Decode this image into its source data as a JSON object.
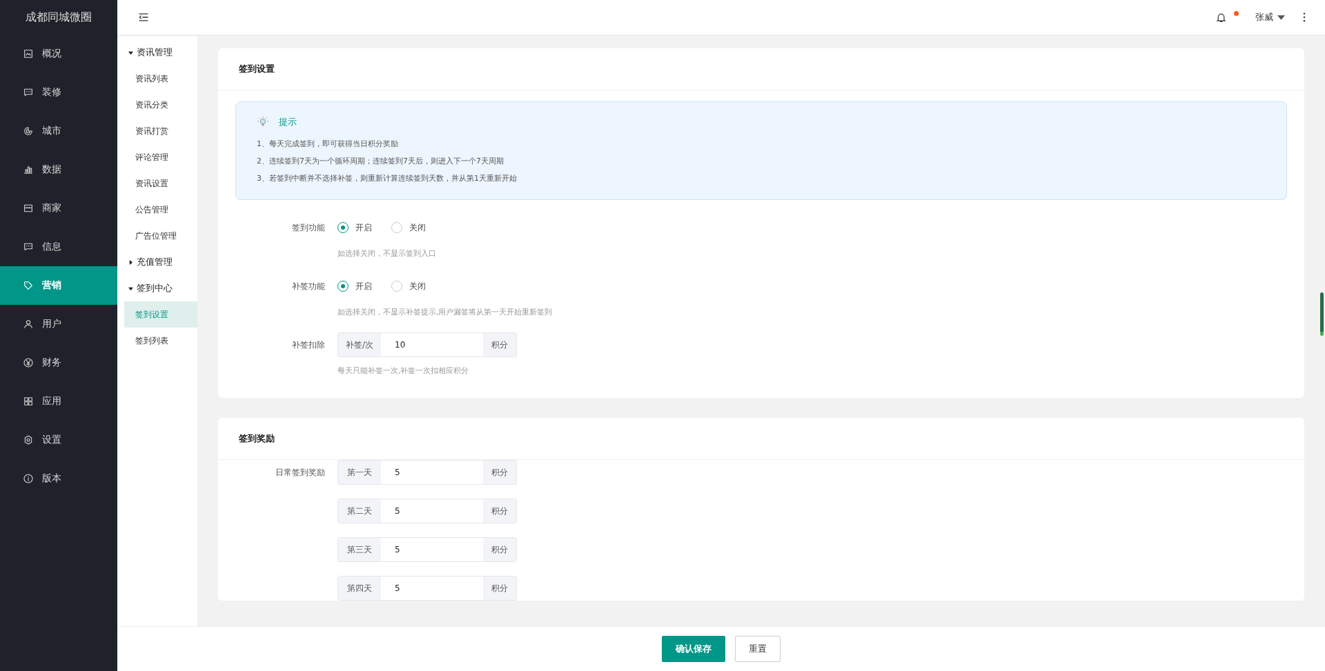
{
  "brand": "成都同城微圈",
  "nav": [
    {
      "label": "概况",
      "selected": false
    },
    {
      "label": "装修",
      "selected": false
    },
    {
      "label": "城市",
      "selected": false
    },
    {
      "label": "数据",
      "selected": false
    },
    {
      "label": "商家",
      "selected": false
    },
    {
      "label": "信息",
      "selected": false
    },
    {
      "label": "营销",
      "selected": true
    },
    {
      "label": "用户",
      "selected": false
    },
    {
      "label": "财务",
      "selected": false
    },
    {
      "label": "应用",
      "selected": false
    },
    {
      "label": "设置",
      "selected": false
    },
    {
      "label": "版本",
      "selected": false
    }
  ],
  "subnav": [
    {
      "label": "资讯管理",
      "expanded": true,
      "children": [
        {
          "label": "资讯列表",
          "selected": false
        },
        {
          "label": "资讯分类",
          "selected": false
        },
        {
          "label": "资讯打赏",
          "selected": false
        },
        {
          "label": "评论管理",
          "selected": false
        },
        {
          "label": "资讯设置",
          "selected": false
        },
        {
          "label": "公告管理",
          "selected": false
        },
        {
          "label": "广告位管理",
          "selected": false
        }
      ]
    },
    {
      "label": "充值管理",
      "expanded": false
    },
    {
      "label": "签到中心",
      "expanded": true,
      "children": [
        {
          "label": "签到设置",
          "selected": true
        },
        {
          "label": "签到列表",
          "selected": false
        }
      ]
    }
  ],
  "header": {
    "user": "张威",
    "notification_dot": true
  },
  "settings_card": {
    "title": "签到设置",
    "tip": {
      "title": "提示",
      "lines": [
        "1、每天完成签到，即可获得当日积分奖励",
        "2、连续签到7天为一个循环周期；连续签到7天后，则进入下一个7天周期",
        "3、若签到中断并不选择补签，则重新计算连续签到天数，并从第1天重新开始"
      ]
    },
    "fields": [
      {
        "kind": "radio",
        "label": "签到功能",
        "options": [
          {
            "label": "开启",
            "selected": true
          },
          {
            "label": "关闭",
            "selected": false
          }
        ],
        "hint": "如选择关闭，不显示签到入口"
      },
      {
        "kind": "radio",
        "label": "补签功能",
        "options": [
          {
            "label": "开启",
            "selected": true
          },
          {
            "label": "关闭",
            "selected": false
          }
        ],
        "hint": "如选择关闭，不显示补签提示,用户漏签将从第一天开始重新签到"
      },
      {
        "kind": "input",
        "label": "补签扣除",
        "prefix": "补签/次",
        "value": "10",
        "suffix": "积分",
        "hint": "每天只能补签一次,补签一次扣相应积分"
      }
    ]
  },
  "reward_card": {
    "title": "签到奖励",
    "label": "日常签到奖励",
    "rows": [
      {
        "prefix": "第一天",
        "value": "5",
        "suffix": "积分"
      },
      {
        "prefix": "第二天",
        "value": "5",
        "suffix": "积分"
      },
      {
        "prefix": "第三天",
        "value": "5",
        "suffix": "积分"
      },
      {
        "prefix": "第四天",
        "value": "5",
        "suffix": "积分"
      }
    ]
  },
  "footer": {
    "save": "确认保存",
    "reset": "重置"
  }
}
